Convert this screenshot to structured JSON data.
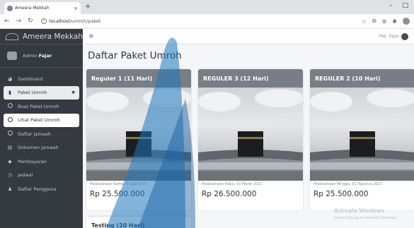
{
  "browser": {
    "tab_title": "Ameera Mekkah",
    "tab_close": "×",
    "new_tab": "+",
    "win_min": "–",
    "win_max": "□",
    "url_host": "localhost",
    "url_path": "/umroh/paket"
  },
  "sidebar": {
    "brand": "Ameera Mekkah",
    "user_prefix": "Admin",
    "user_name": "Fajar",
    "items": [
      {
        "label": "Dashboard",
        "icon": "gauge-icon"
      },
      {
        "label": "Paket Umroh",
        "icon": "book-icon"
      },
      {
        "label": "Buat Paket Umroh",
        "icon": "circle-icon"
      },
      {
        "label": "Lihat Paket Umroh",
        "icon": "circle-icon"
      },
      {
        "label": "Daftar Jamaah",
        "icon": "circle-icon"
      },
      {
        "label": "Dokumen Jamaah",
        "icon": "file-icon"
      },
      {
        "label": "Pembayaran",
        "icon": "tag-icon"
      },
      {
        "label": "Jadwal",
        "icon": "clock-icon"
      },
      {
        "label": "Daftar Pengguna",
        "icon": "user-icon"
      }
    ]
  },
  "topbar": {
    "greeting": "Hai, Fajar"
  },
  "page": {
    "title": "Daftar Paket Umroh"
  },
  "packages": [
    {
      "name": "Reguler 1 (11 Hari)",
      "schedule": "Pelaksanaan Kamis, 01 Juli 2021",
      "price": "Rp 25.500.000"
    },
    {
      "name": "REGULER 3 (12 Hari)",
      "schedule": "Pelaksanaan Rabu, 10 Maret 2021",
      "price": "Rp 26.500.000"
    },
    {
      "name": "REGULER 2 (10 Hari)",
      "schedule": "Pelaksanaan Minggu, 01 Agustus 2021",
      "price": "Rp 25.500.000"
    },
    {
      "name": "Testing (20 Hari)"
    }
  ],
  "windows_watermark": {
    "line1": "Activate Windows",
    "line2": "Go to Settings to activate Windows."
  }
}
